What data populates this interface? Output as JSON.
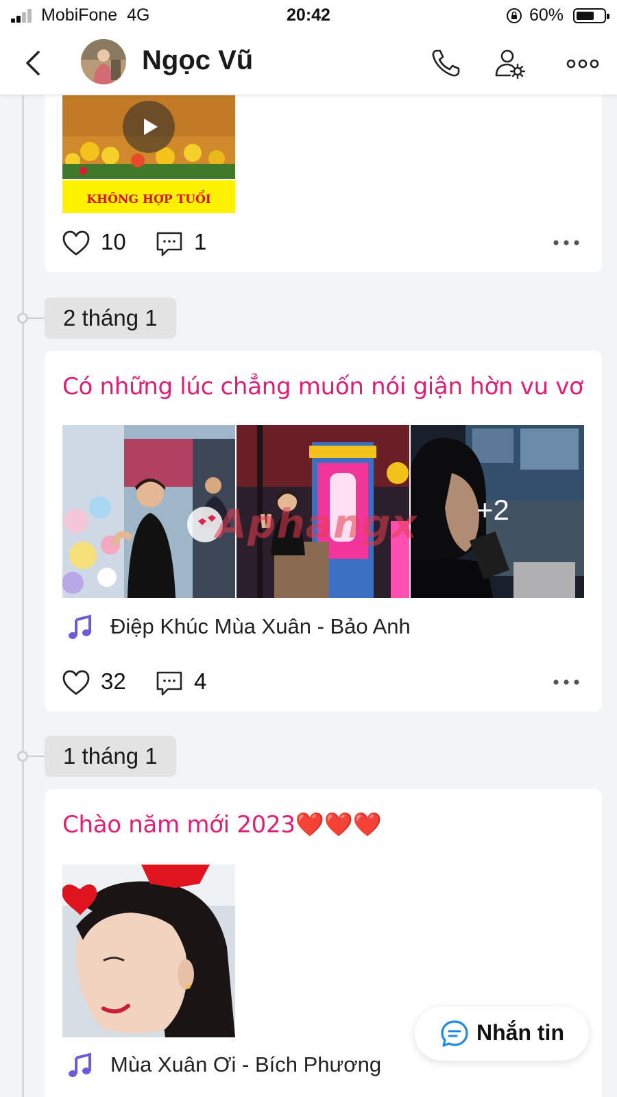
{
  "status_bar": {
    "carrier": "MobiFone",
    "network": "4G",
    "time": "20:42",
    "battery": "60%",
    "battery_level": 0.6
  },
  "header": {
    "name": "Ngọc Vũ",
    "icons": [
      "back-chevron-icon",
      "phone-icon",
      "user-settings-icon",
      "more-horizontal-icon"
    ]
  },
  "posts": [
    {
      "date": "",
      "title": "",
      "thumbnail_caption": "KHÔNG HỢP TUỔI",
      "likes": "10",
      "comments": "1"
    },
    {
      "date": "2 tháng 1",
      "title": "Có những lúc chẳng muốn nói giận hờn vu vơ",
      "photo_overlay": "+2",
      "watermark": "Aphangx",
      "song": "Điệp Khúc Mùa Xuân - Bảo Anh",
      "likes": "32",
      "comments": "4"
    },
    {
      "date": "1 tháng 1",
      "title": "Chào năm mới 2023",
      "title_emoji": "❤️❤️❤️",
      "song": "Mùa Xuân Ơi - Bích Phương"
    }
  ],
  "fab": {
    "label": "Nhắn tin"
  },
  "colors": {
    "accent_pink": "#e11d74",
    "music_purple": "#6b5bd6",
    "chat_blue": "#1e88e5"
  }
}
